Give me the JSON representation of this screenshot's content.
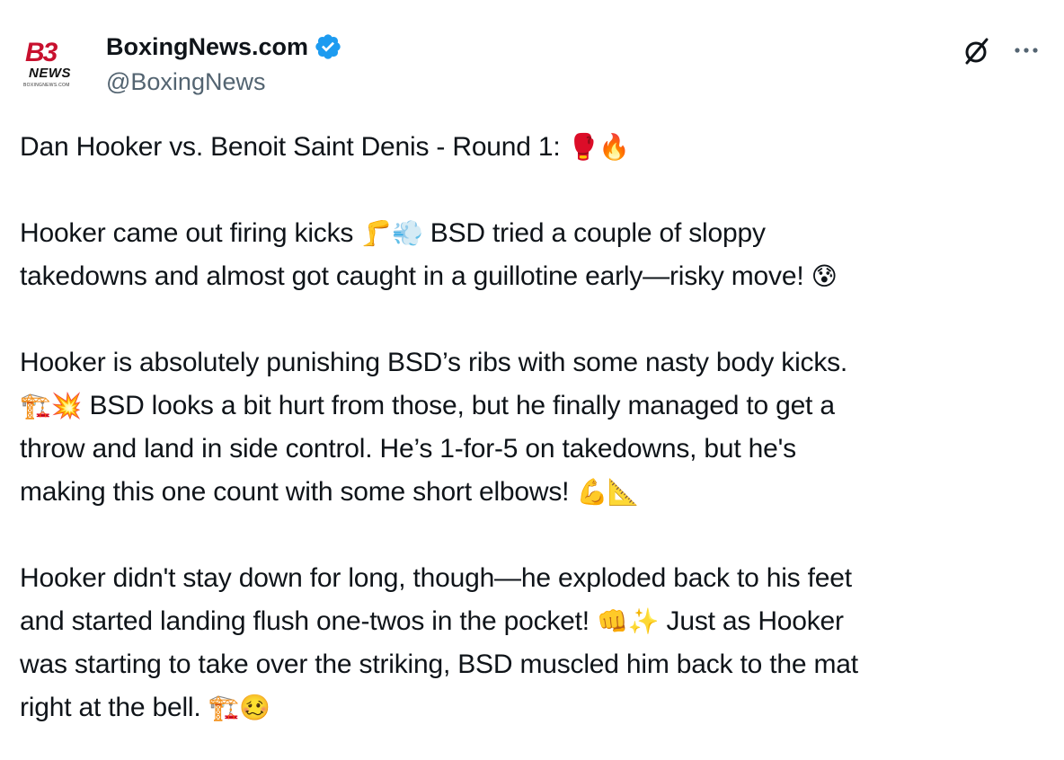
{
  "account": {
    "display_name": "BoxingNews.com",
    "handle": "@BoxingNews",
    "logo_mark": "B3",
    "logo_word": "NEWS",
    "logo_tiny": "BOXINGNEWS.COM",
    "verified": true,
    "verified_color": "#1d9bf0"
  },
  "actions": {
    "grok_icon": "grok-icon",
    "more_icon": "more-icon"
  },
  "tweet": {
    "p1_text": "Dan Hooker vs. Benoit Saint Denis - Round 1: ",
    "p1_emojis": "🥊🔥",
    "p2_line1_a": "Hooker came out firing kicks ",
    "p2_line1_emoji": "🦵💨",
    "p2_line1_b": " BSD tried a couple of sloppy",
    "p2_line2_a": "takedowns and almost got caught in a guillotine early—risky move! ",
    "p2_line2_emoji": "😰",
    "p3_line1": "Hooker is absolutely punishing BSD’s ribs with some nasty body kicks.",
    "p3_line2_emoji": "🏗️💥",
    "p3_line2_text": " BSD looks a bit hurt from those, but he finally managed to get a",
    "p3_line3": "throw and land in side control. He’s 1-for-5 on takedowns, but he's",
    "p3_line4_text": "making this one count with some short elbows! ",
    "p3_line4_emoji": "💪📐",
    "p4_line1": "Hooker didn't stay down for long, though—he exploded back to his feet",
    "p4_line2_text": "and started landing flush one-twos in the pocket! ",
    "p4_line2_emoji": "👊✨",
    "p4_line2_b": " Just as Hooker",
    "p4_line3": "was starting to take over the striking, BSD muscled him back to the mat",
    "p4_line4_text": "right at the bell. ",
    "p4_line4_emoji": "🏗️🥴"
  }
}
